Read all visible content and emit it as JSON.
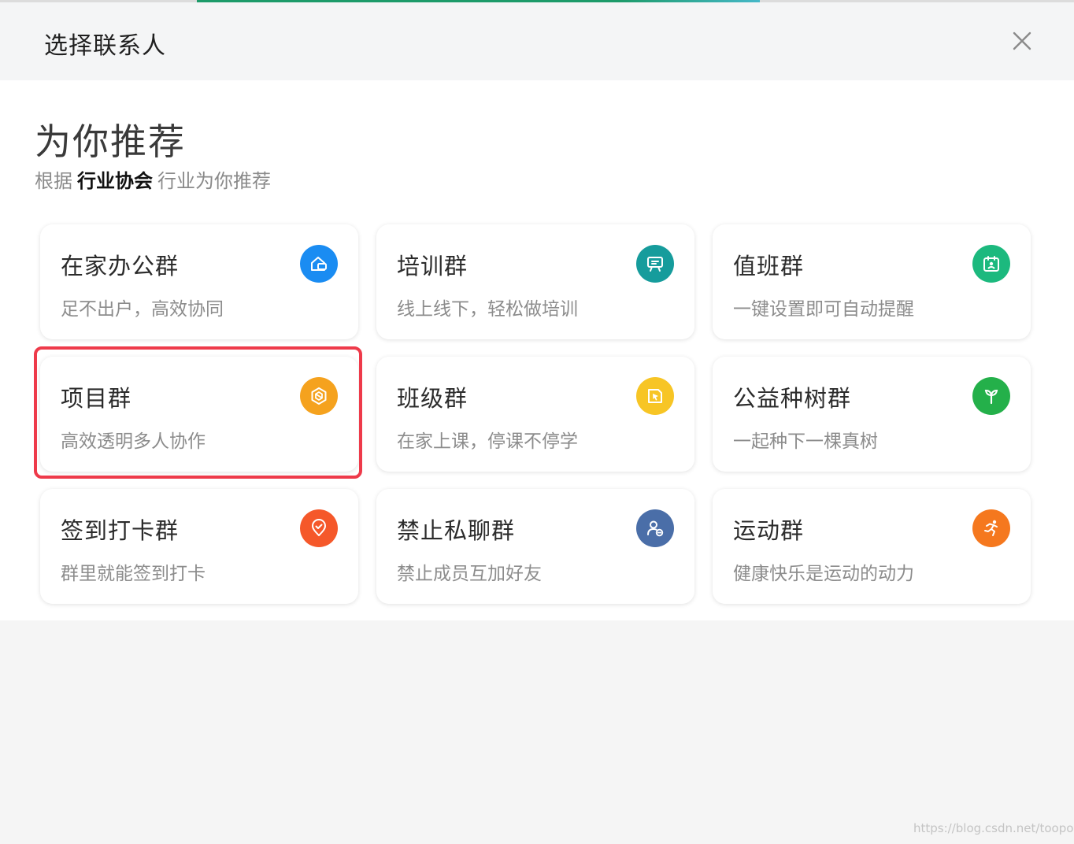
{
  "dialog": {
    "title": "选择联系人"
  },
  "recommend": {
    "title": "为你推荐",
    "subtitle_prefix": "根据",
    "subtitle_industry": "行业协会",
    "subtitle_suffix": "行业为你推荐"
  },
  "cards": [
    {
      "name": "在家办公群",
      "desc": "足不出户，高效协同",
      "icon": "home-office-icon",
      "color": "#1a8cf2"
    },
    {
      "name": "培训群",
      "desc": "线上线下，轻松做培训",
      "icon": "presentation-board-icon",
      "color": "#169c9c"
    },
    {
      "name": "值班群",
      "desc": "一键设置即可自动提醒",
      "icon": "duty-calendar-icon",
      "color": "#1cb97e"
    },
    {
      "name": "项目群",
      "desc": "高效透明多人协作",
      "icon": "project-hexagon-icon",
      "color": "#f5a21e"
    },
    {
      "name": "班级群",
      "desc": "在家上课，停课不停学",
      "icon": "book-pointer-icon",
      "color": "#f7c525"
    },
    {
      "name": "公益种树群",
      "desc": "一起种下一棵真树",
      "icon": "sprout-icon",
      "color": "#24b04a"
    },
    {
      "name": "签到打卡群",
      "desc": "群里就能签到打卡",
      "icon": "check-location-icon",
      "color": "#f5582a"
    },
    {
      "name": "禁止私聊群",
      "desc": "禁止成员互加好友",
      "icon": "user-block-icon",
      "color": "#4a6ea8"
    },
    {
      "name": "运动群",
      "desc": "健康快乐是运动的动力",
      "icon": "running-icon",
      "color": "#f5781e"
    }
  ],
  "watermark": "https://blog.csdn.net/toopoo"
}
